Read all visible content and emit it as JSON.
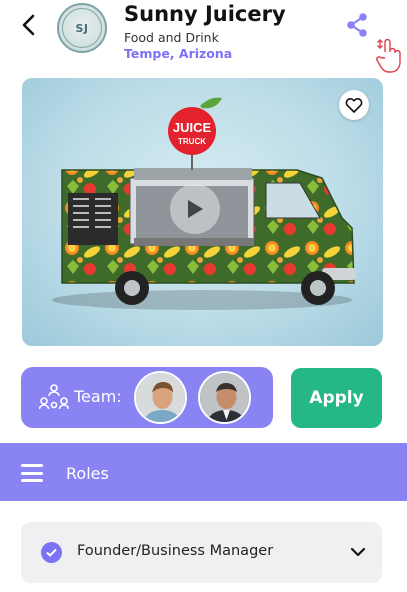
{
  "business": {
    "initials": "SJ",
    "name": "Sunny Juicery",
    "category": "Food and Drink",
    "location": "Tempe, Arizona"
  },
  "hero": {
    "truck_sign_line1": "JUICE",
    "truck_sign_line2": "TRUCK"
  },
  "team": {
    "label": "Team:"
  },
  "apply": {
    "label": "Apply"
  },
  "roles": {
    "title": "Roles",
    "items": [
      {
        "label": "Founder/Business Manager",
        "checked": true
      }
    ]
  },
  "colors": {
    "accent": "#8a83f3",
    "apply": "#25b784",
    "location": "#7c72f4"
  }
}
